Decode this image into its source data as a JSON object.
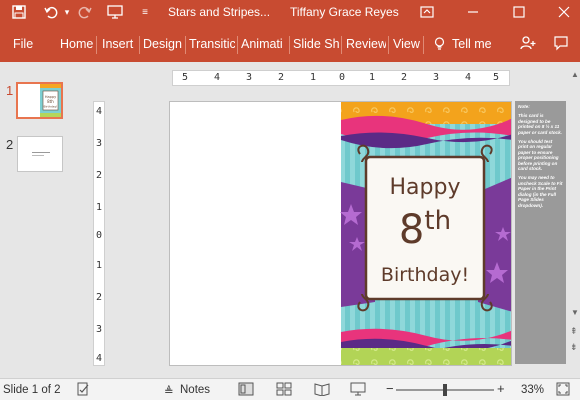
{
  "titlebar": {
    "doc_title": "Stars and Stripes...",
    "user_name": "Tiffany Grace Reyes",
    "save_icon": "save-icon",
    "undo_icon": "undo-icon",
    "redo_icon": "redo-icon",
    "present_icon": "present-from-start-icon",
    "customize_icon": "customize-toolbar-icon",
    "ribbon_display_icon": "ribbon-display-options-icon",
    "minimize_icon": "minimize-icon",
    "maximize_icon": "maximize-icon",
    "close_icon": "close-icon",
    "color": "#c84b31"
  },
  "ribbon": {
    "tabs": [
      "File",
      "Home",
      "Insert",
      "Design",
      "Transitic",
      "Animati",
      "Slide Sho",
      "Review",
      "View"
    ],
    "tell_me": "Tell me",
    "share_icon": "share-icon"
  },
  "thumbnails": [
    {
      "number": "1",
      "selected": true
    },
    {
      "number": "2",
      "selected": false
    }
  ],
  "rulers": {
    "horizontal": [
      "5",
      "4",
      "3",
      "2",
      "1",
      "0",
      "1",
      "2",
      "3",
      "4",
      "5"
    ],
    "vertical": [
      "4",
      "3",
      "2",
      "1",
      "0",
      "1",
      "2",
      "3",
      "4"
    ]
  },
  "card": {
    "line1": "Happy",
    "line2_number": "8",
    "line2_suffix": "th",
    "line3": "Birthday!"
  },
  "note": {
    "heading": "Note:",
    "paragraphs": [
      "This card is designed to be printed on 8 ½ x 11 paper or card stock.",
      "You should test print on regular paper to ensure proper positioning before printing on card stock.",
      "You may need to uncheck Scale to Fit Paper in the Print dialog (in the Full Page Slides dropdown)."
    ]
  },
  "status": {
    "slide_info": "Slide 1 of 2",
    "notes": "Notes",
    "zoom": "33%",
    "zoom_fraction": 0.5
  }
}
